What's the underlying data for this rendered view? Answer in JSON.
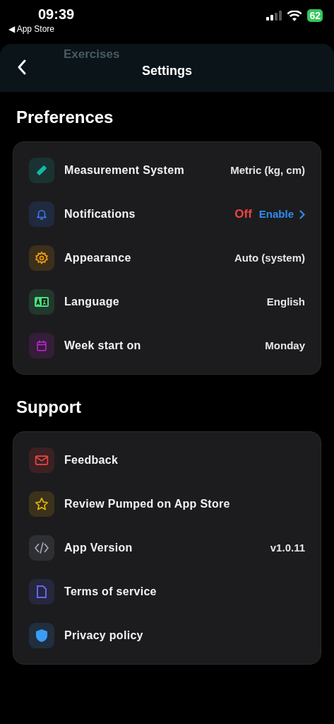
{
  "status_bar": {
    "time": "09:39",
    "back_app": "◀ App Store",
    "battery": "62"
  },
  "header": {
    "title": "Settings",
    "behind": "Exercises"
  },
  "sections": [
    {
      "title": "Preferences",
      "rows": [
        {
          "label": "Measurement System",
          "value": "Metric (kg, cm)",
          "color": "#14b8a6"
        },
        {
          "label": "Notifications",
          "kind": "status",
          "status": "Off",
          "action": "Enable",
          "color": "#3b82f6"
        },
        {
          "label": "Appearance",
          "value": "Auto (system)",
          "color": "#f59e0b"
        },
        {
          "label": "Language",
          "value": "English",
          "color": "#4ade80"
        },
        {
          "label": "Week start on",
          "value": "Monday",
          "color": "#c026d3"
        }
      ]
    },
    {
      "title": "Support",
      "rows": [
        {
          "label": "Feedback",
          "color": "#ef4444"
        },
        {
          "label": "Review Pumped on App Store",
          "color": "#eab308"
        },
        {
          "label": "App Version",
          "value": "v1.0.11",
          "color": "#9ca3af"
        },
        {
          "label": "Terms of service",
          "color": "#6366f1"
        },
        {
          "label": "Privacy policy",
          "color": "#3b9cf6"
        }
      ]
    }
  ]
}
